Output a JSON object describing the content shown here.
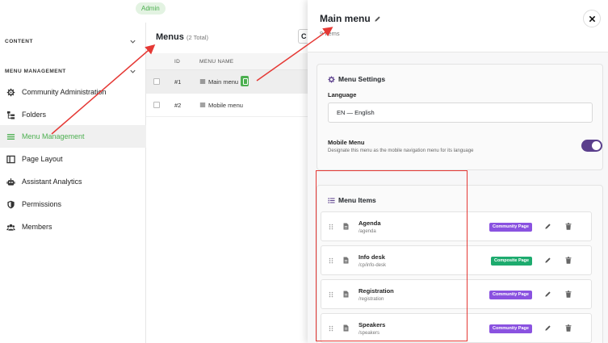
{
  "header": {
    "role_badge": "Admin"
  },
  "sidebar": {
    "sections": [
      {
        "label": "CONTENT"
      },
      {
        "label": "MENU MANAGEMENT"
      }
    ],
    "items": [
      {
        "label": "Community Administration",
        "icon": "gear-icon"
      },
      {
        "label": "Folders",
        "icon": "folder-tree-icon"
      },
      {
        "label": "Menu Management",
        "icon": "menu-lines-icon",
        "active": true
      },
      {
        "label": "Page Layout",
        "icon": "layout-icon"
      },
      {
        "label": "Assistant Analytics",
        "icon": "robot-icon"
      },
      {
        "label": "Permissions",
        "icon": "shield-icon"
      },
      {
        "label": "Members",
        "icon": "users-icon"
      }
    ]
  },
  "menus": {
    "title": "Menus",
    "count": "(2 Total)",
    "filter_stub": "C",
    "columns": {
      "id": "ID",
      "name": "MENU NAME"
    },
    "rows": [
      {
        "id": "#1",
        "name": "Main menu"
      },
      {
        "id": "#2",
        "name": "Mobile menu"
      }
    ]
  },
  "drawer": {
    "title": "Main menu",
    "subtitle": "9 Items",
    "settings": {
      "title": "Menu Settings",
      "language_label": "Language",
      "language_value": "EN — English",
      "mobile_label": "Mobile Menu",
      "mobile_desc": "Designate this menu as the mobile navigation menu for its language",
      "mobile_enabled": true
    },
    "menu_items_title": "Menu Items",
    "items": [
      {
        "name": "Agenda",
        "path": "/agenda",
        "badge": "Community Page",
        "badge_color": "#8a52e0"
      },
      {
        "name": "Info desk",
        "path": "/cp/info-desk",
        "badge": "Composite Page",
        "badge_color": "#1dab6e"
      },
      {
        "name": "Registration",
        "path": "/registration",
        "badge": "Community Page",
        "badge_color": "#8a52e0"
      },
      {
        "name": "Speakers",
        "path": "/speakers",
        "badge": "Community Page",
        "badge_color": "#8a52e0"
      }
    ]
  },
  "colors": {
    "accent_green": "#4caf50",
    "toggle_purple": "#5b3f8c",
    "annotation_red": "#e53935"
  }
}
